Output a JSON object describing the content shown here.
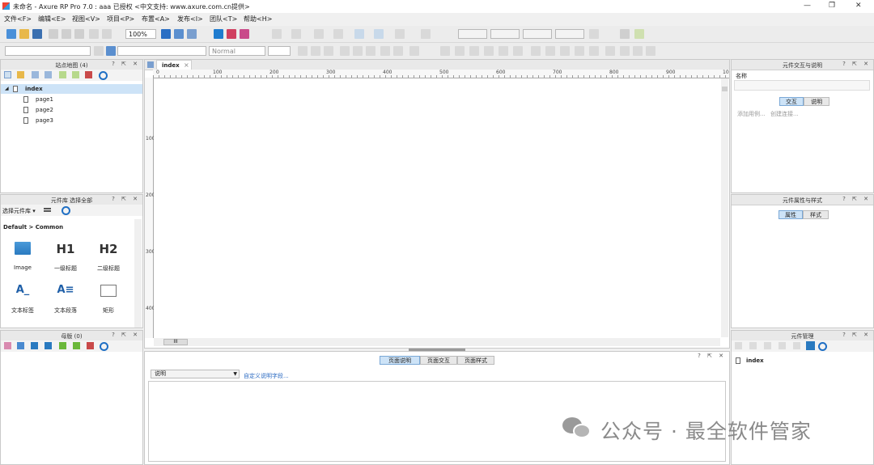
{
  "app": {
    "title": "未命名 - Axure RP Pro 7.0 : aaa 已授权    <中文支持: www.axure.com.cn提供>",
    "window_controls": {
      "minimize": "—",
      "maximize": "❐",
      "close": "✕"
    }
  },
  "menu": [
    "文件<F>",
    "编辑<E>",
    "视图<V>",
    "项目<P>",
    "布置<A>",
    "发布<I>",
    "团队<T>",
    "帮助<H>"
  ],
  "toolbar": {
    "zoom": "100%",
    "style": "Normal"
  },
  "sitemap": {
    "title": "站点地图 (4)",
    "controls": "? ⇱ ✕",
    "root": "index",
    "pages": [
      "page1",
      "page2",
      "page3"
    ]
  },
  "widgets": {
    "title": "元件库 选择全部",
    "controls": "? ⇱ ✕",
    "selector": "选择元件库 ▾",
    "library": "Default > Common",
    "items": [
      {
        "glyph": "",
        "label": "Image",
        "icon": "image-icon"
      },
      {
        "glyph": "H1",
        "label": "一级标题",
        "icon": "heading1-icon"
      },
      {
        "glyph": "H2",
        "label": "二级标题",
        "icon": "heading2-icon"
      },
      {
        "glyph": "A_",
        "label": "文本标签",
        "icon": "text-label-icon"
      },
      {
        "glyph": "A≡",
        "label": "文本段落",
        "icon": "paragraph-icon"
      },
      {
        "glyph": "",
        "label": "矩形",
        "icon": "rectangle-icon"
      }
    ]
  },
  "masters": {
    "title": "母版 (0)",
    "controls": "? ⇱ ✕"
  },
  "canvas": {
    "tab": "index",
    "tab_close": "×",
    "ruler_h": [
      "0",
      "100",
      "200",
      "300",
      "400",
      "500",
      "600",
      "700",
      "800",
      "900",
      "10"
    ],
    "ruler_v": [
      "100",
      "200",
      "300",
      "400"
    ],
    "scroll_thumb": "III"
  },
  "page_props": {
    "controls": "? ⇱ ✕",
    "tabs": [
      "页面说明",
      "页面交互",
      "页面样式"
    ],
    "notes_select": "说明",
    "custom_fields_link": "自定义说明字段..."
  },
  "interactions": {
    "title": "元件交互与说明",
    "controls": "? ⇱ ✕",
    "name_label": "名称",
    "tabs": [
      "交互",
      "说明"
    ],
    "add_case": "添加用例...",
    "create_link": "创建连接..."
  },
  "properties": {
    "title": "元件属性与样式",
    "controls": "? ⇱ ✕",
    "tabs": [
      "属性",
      "样式"
    ]
  },
  "manager": {
    "title": "元件管理",
    "controls": "? ⇱ ✕",
    "item": "index"
  },
  "watermark": "公众号 · 最全软件管家"
}
